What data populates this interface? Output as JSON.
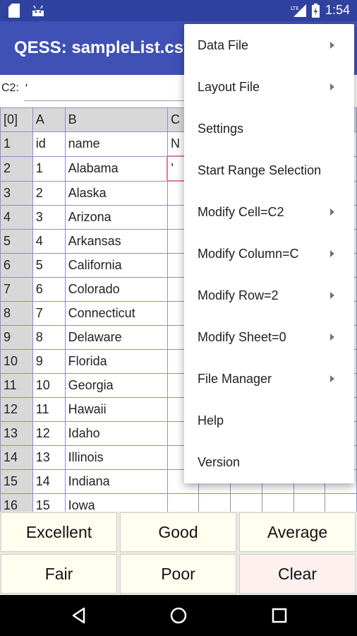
{
  "status_bar": {
    "time": "1:54",
    "network": "LTE",
    "icons": [
      "sd-card-icon",
      "android-icon",
      "lte-signal-icon",
      "battery-icon"
    ]
  },
  "app_bar": {
    "title": "QESS: sampleList.csv"
  },
  "cell_editor": {
    "label": "C2:",
    "value": "'"
  },
  "grid": {
    "corner": "[0]",
    "columns": [
      "A",
      "B",
      "C",
      "",
      "",
      "",
      "",
      ""
    ],
    "rows": [
      {
        "num": "1",
        "a": "id",
        "b": "name",
        "c": "N"
      },
      {
        "num": "2",
        "a": "1",
        "b": "Alabama",
        "c": "'"
      },
      {
        "num": "3",
        "a": "2",
        "b": "Alaska",
        "c": ""
      },
      {
        "num": "4",
        "a": "3",
        "b": "Arizona",
        "c": ""
      },
      {
        "num": "5",
        "a": "4",
        "b": "Arkansas",
        "c": ""
      },
      {
        "num": "6",
        "a": "5",
        "b": "California",
        "c": ""
      },
      {
        "num": "7",
        "a": "6",
        "b": "Colorado",
        "c": ""
      },
      {
        "num": "8",
        "a": "7",
        "b": "Connecticut",
        "c": ""
      },
      {
        "num": "9",
        "a": "8",
        "b": "Delaware",
        "c": ""
      },
      {
        "num": "10",
        "a": "9",
        "b": "Florida",
        "c": ""
      },
      {
        "num": "11",
        "a": "10",
        "b": "Georgia",
        "c": ""
      },
      {
        "num": "12",
        "a": "11",
        "b": "Hawaii",
        "c": ""
      },
      {
        "num": "13",
        "a": "12",
        "b": "Idaho",
        "c": ""
      },
      {
        "num": "14",
        "a": "13",
        "b": "Illinois",
        "c": ""
      },
      {
        "num": "15",
        "a": "14",
        "b": "Indiana",
        "c": ""
      },
      {
        "num": "16",
        "a": "15",
        "b": "Iowa",
        "c": ""
      }
    ]
  },
  "buttons": [
    {
      "label": "Excellent"
    },
    {
      "label": "Good"
    },
    {
      "label": "Average"
    },
    {
      "label": "Fair"
    },
    {
      "label": "Poor"
    },
    {
      "label": "Clear"
    }
  ],
  "menu": {
    "items": [
      {
        "label": "Data File",
        "submenu": true
      },
      {
        "label": "Layout File",
        "submenu": true
      },
      {
        "label": "Settings",
        "submenu": false
      },
      {
        "label": "Start Range Selection",
        "submenu": false
      },
      {
        "label": "Modify Cell=C2",
        "submenu": true
      },
      {
        "label": "Modify Column=C",
        "submenu": true
      },
      {
        "label": "Modify Row=2",
        "submenu": true
      },
      {
        "label": "Modify Sheet=0",
        "submenu": true
      },
      {
        "label": "File Manager",
        "submenu": true
      },
      {
        "label": "Help",
        "submenu": false
      },
      {
        "label": "Version",
        "submenu": false
      }
    ]
  },
  "nav_bar": {
    "icons": [
      "back-icon",
      "home-icon",
      "recents-icon"
    ]
  },
  "colors": {
    "status_bar": "#3042a0",
    "app_bar": "#3f51b5",
    "grid_line": "#8c8fc8",
    "header_bg": "#d8d8d8",
    "selected_border": "#e07a98",
    "button_bg": "#fffff0",
    "clear_bg": "#fff0f0"
  }
}
